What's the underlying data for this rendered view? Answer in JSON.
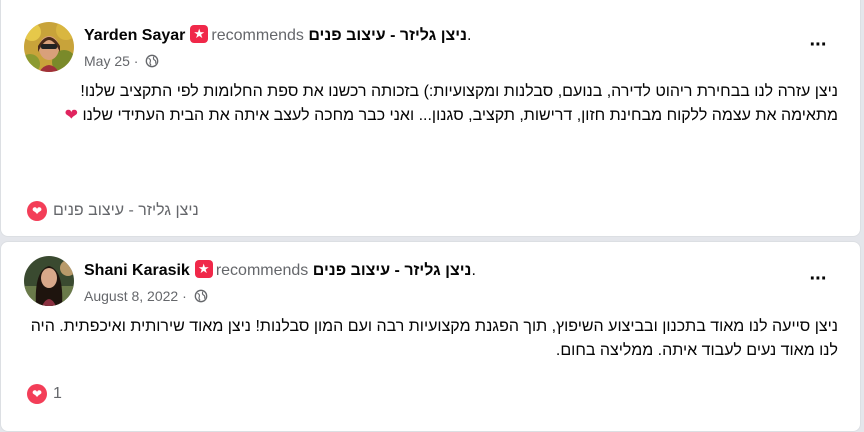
{
  "colors": {
    "background": "#e4e6eb",
    "card": "#ffffff",
    "secondary_text": "#65676b",
    "recommend_badge": "#f02849",
    "love_reaction": "#f33e58"
  },
  "reviews": [
    {
      "author": "Yarden Sayar",
      "recommends": "recommends",
      "page": "ניצן גליזר - עיצוב פנים",
      "page_suffix": ".",
      "date": "May 25",
      "privacy_icon": "globe-icon",
      "paragraphs": [
        "ניצן עזרה לנו בבחירת ריהוט לדירה, בנועם, סבלנות ומקצועיות:) בזכותה רכשנו את ספת החלומות לפי התקציב שלנו!",
        "מתאימה את עצמה ללקוח מבחינת חזון, דרישות, תקציב, סגנון... ואני כבר מחכה לעצב איתה את הבית העתידי שלנו"
      ],
      "end_emoji": "❤",
      "footer_text": "ניצן גליזר - עיצוב פנים",
      "reaction_count": ""
    },
    {
      "author": "Shani Karasik",
      "recommends": "recommends",
      "page": "ניצן גליזר - עיצוב פנים",
      "page_suffix": ".",
      "date": "August 8, 2022",
      "privacy_icon": "globe-icon",
      "paragraphs": [
        "ניצן סייעה לנו מאוד בתכנון ובביצוע השיפוץ, תוך הפגנת מקצועיות רבה ועם המון סבלנות! ניצן מאוד שירותית ואיכפתית. היה לנו מאוד נעים לעבוד איתה. ממליצה בחום."
      ],
      "end_emoji": "",
      "footer_text": "",
      "reaction_count": "1"
    }
  ],
  "icons": {
    "more": "more-options-icon",
    "recommend": "recommend-star-icon",
    "reaction": "love-reaction-icon"
  }
}
